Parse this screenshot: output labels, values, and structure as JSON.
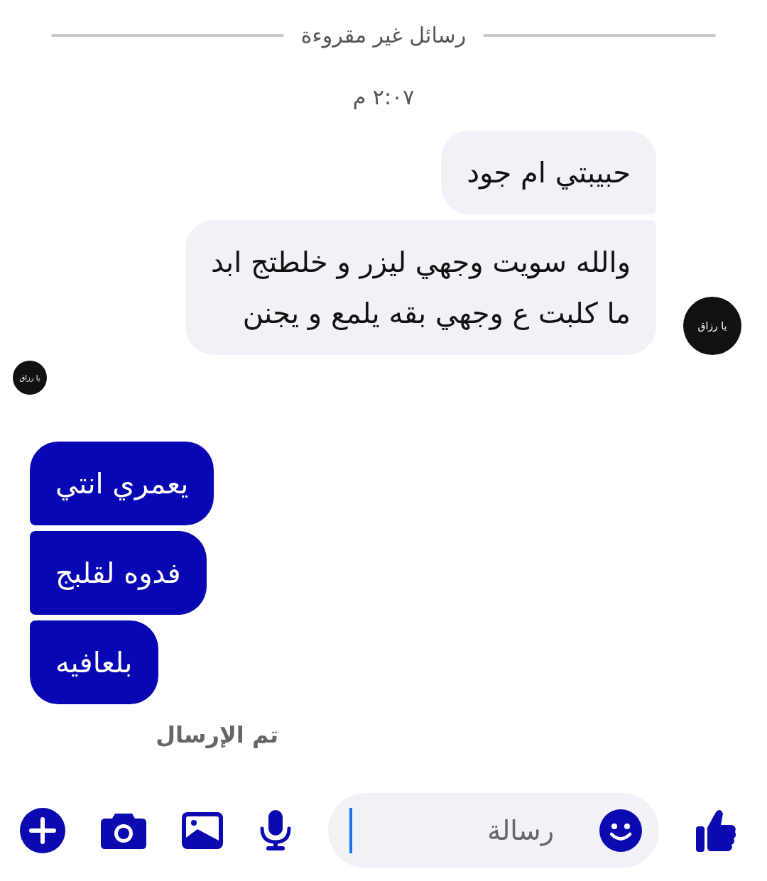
{
  "divider": {
    "label": "رسائل غير مقروءة"
  },
  "timestamp": "٢:٠٧ م",
  "received": {
    "avatar": "يا رزاق",
    "messages": [
      {
        "text": "حبيبتي ام جود"
      },
      {
        "text": "والله سويت وجهي ليزر و خلطتج ابد\nما كلبت ع وجهي بقه يلمع و يجنن"
      }
    ]
  },
  "seen_avatar": "يا رزاق",
  "sent": {
    "messages": [
      {
        "text": "يعمري انتي"
      },
      {
        "text": "فدوه لقلبج"
      },
      {
        "text": "بلعافيه"
      }
    ],
    "status": "تم الإرسال"
  },
  "composer": {
    "placeholder": "رسالة"
  }
}
